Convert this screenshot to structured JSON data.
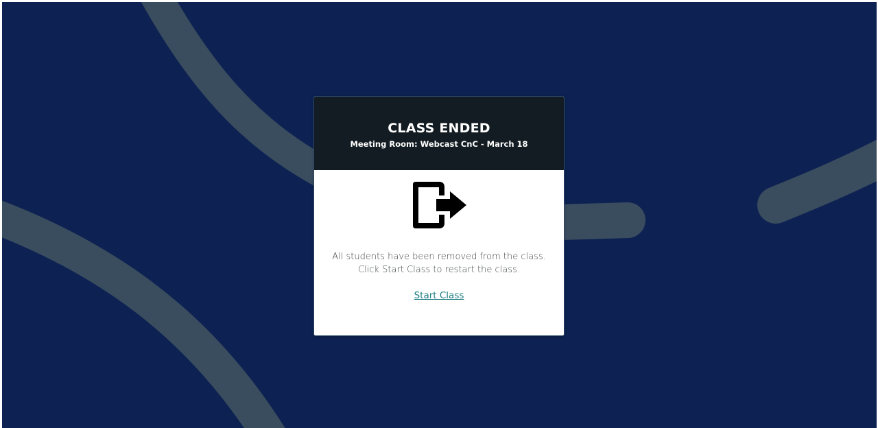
{
  "colors": {
    "background": "#0d2252",
    "decorative_stroke": "#3a4d5f",
    "header_background": "#131c22",
    "link": "#1f7d84"
  },
  "dialog": {
    "title": "CLASS ENDED",
    "subtitle": "Meeting Room: Webcast CnC - March 18",
    "icon": "exit-icon",
    "message_line1": "All students have been removed from the class.",
    "message_line2": "Click Start Class to restart the class.",
    "action_label": "Start Class"
  }
}
